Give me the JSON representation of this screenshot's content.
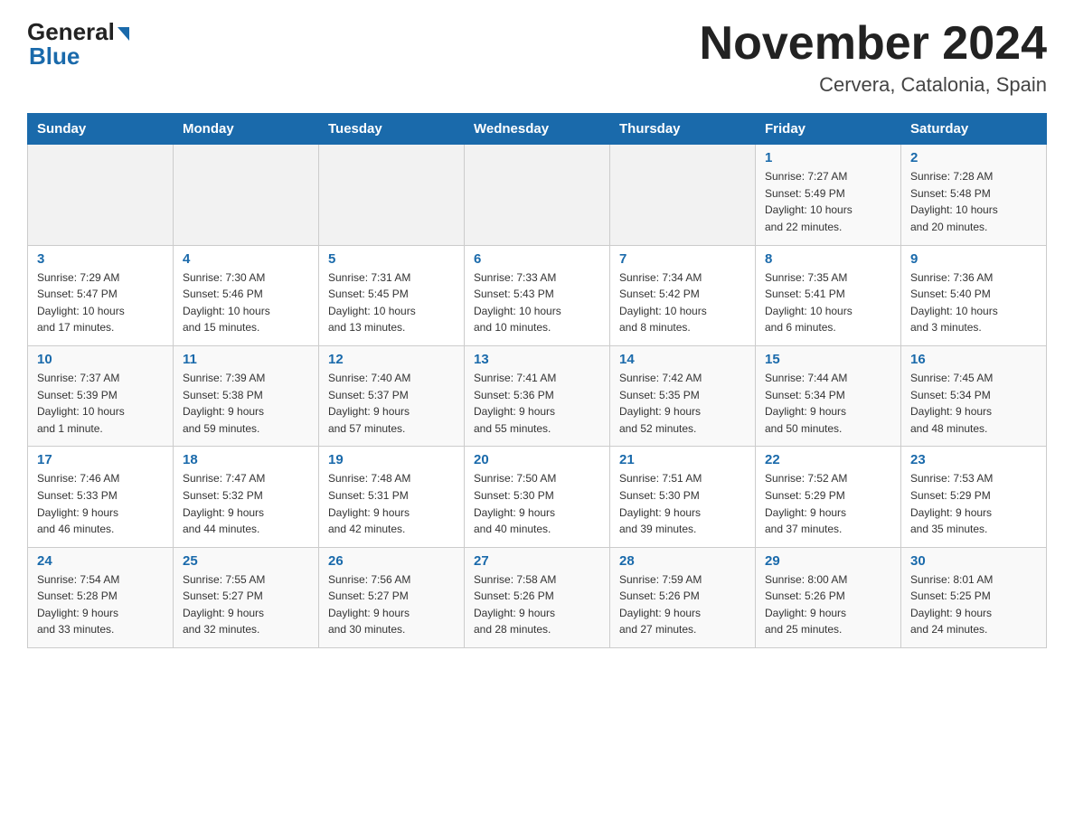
{
  "header": {
    "logo_top": "General",
    "logo_bottom": "Blue",
    "title": "November 2024",
    "subtitle": "Cervera, Catalonia, Spain"
  },
  "days_of_week": [
    "Sunday",
    "Monday",
    "Tuesday",
    "Wednesday",
    "Thursday",
    "Friday",
    "Saturday"
  ],
  "weeks": [
    [
      {
        "day": "",
        "info": ""
      },
      {
        "day": "",
        "info": ""
      },
      {
        "day": "",
        "info": ""
      },
      {
        "day": "",
        "info": ""
      },
      {
        "day": "",
        "info": ""
      },
      {
        "day": "1",
        "info": "Sunrise: 7:27 AM\nSunset: 5:49 PM\nDaylight: 10 hours\nand 22 minutes."
      },
      {
        "day": "2",
        "info": "Sunrise: 7:28 AM\nSunset: 5:48 PM\nDaylight: 10 hours\nand 20 minutes."
      }
    ],
    [
      {
        "day": "3",
        "info": "Sunrise: 7:29 AM\nSunset: 5:47 PM\nDaylight: 10 hours\nand 17 minutes."
      },
      {
        "day": "4",
        "info": "Sunrise: 7:30 AM\nSunset: 5:46 PM\nDaylight: 10 hours\nand 15 minutes."
      },
      {
        "day": "5",
        "info": "Sunrise: 7:31 AM\nSunset: 5:45 PM\nDaylight: 10 hours\nand 13 minutes."
      },
      {
        "day": "6",
        "info": "Sunrise: 7:33 AM\nSunset: 5:43 PM\nDaylight: 10 hours\nand 10 minutes."
      },
      {
        "day": "7",
        "info": "Sunrise: 7:34 AM\nSunset: 5:42 PM\nDaylight: 10 hours\nand 8 minutes."
      },
      {
        "day": "8",
        "info": "Sunrise: 7:35 AM\nSunset: 5:41 PM\nDaylight: 10 hours\nand 6 minutes."
      },
      {
        "day": "9",
        "info": "Sunrise: 7:36 AM\nSunset: 5:40 PM\nDaylight: 10 hours\nand 3 minutes."
      }
    ],
    [
      {
        "day": "10",
        "info": "Sunrise: 7:37 AM\nSunset: 5:39 PM\nDaylight: 10 hours\nand 1 minute."
      },
      {
        "day": "11",
        "info": "Sunrise: 7:39 AM\nSunset: 5:38 PM\nDaylight: 9 hours\nand 59 minutes."
      },
      {
        "day": "12",
        "info": "Sunrise: 7:40 AM\nSunset: 5:37 PM\nDaylight: 9 hours\nand 57 minutes."
      },
      {
        "day": "13",
        "info": "Sunrise: 7:41 AM\nSunset: 5:36 PM\nDaylight: 9 hours\nand 55 minutes."
      },
      {
        "day": "14",
        "info": "Sunrise: 7:42 AM\nSunset: 5:35 PM\nDaylight: 9 hours\nand 52 minutes."
      },
      {
        "day": "15",
        "info": "Sunrise: 7:44 AM\nSunset: 5:34 PM\nDaylight: 9 hours\nand 50 minutes."
      },
      {
        "day": "16",
        "info": "Sunrise: 7:45 AM\nSunset: 5:34 PM\nDaylight: 9 hours\nand 48 minutes."
      }
    ],
    [
      {
        "day": "17",
        "info": "Sunrise: 7:46 AM\nSunset: 5:33 PM\nDaylight: 9 hours\nand 46 minutes."
      },
      {
        "day": "18",
        "info": "Sunrise: 7:47 AM\nSunset: 5:32 PM\nDaylight: 9 hours\nand 44 minutes."
      },
      {
        "day": "19",
        "info": "Sunrise: 7:48 AM\nSunset: 5:31 PM\nDaylight: 9 hours\nand 42 minutes."
      },
      {
        "day": "20",
        "info": "Sunrise: 7:50 AM\nSunset: 5:30 PM\nDaylight: 9 hours\nand 40 minutes."
      },
      {
        "day": "21",
        "info": "Sunrise: 7:51 AM\nSunset: 5:30 PM\nDaylight: 9 hours\nand 39 minutes."
      },
      {
        "day": "22",
        "info": "Sunrise: 7:52 AM\nSunset: 5:29 PM\nDaylight: 9 hours\nand 37 minutes."
      },
      {
        "day": "23",
        "info": "Sunrise: 7:53 AM\nSunset: 5:29 PM\nDaylight: 9 hours\nand 35 minutes."
      }
    ],
    [
      {
        "day": "24",
        "info": "Sunrise: 7:54 AM\nSunset: 5:28 PM\nDaylight: 9 hours\nand 33 minutes."
      },
      {
        "day": "25",
        "info": "Sunrise: 7:55 AM\nSunset: 5:27 PM\nDaylight: 9 hours\nand 32 minutes."
      },
      {
        "day": "26",
        "info": "Sunrise: 7:56 AM\nSunset: 5:27 PM\nDaylight: 9 hours\nand 30 minutes."
      },
      {
        "day": "27",
        "info": "Sunrise: 7:58 AM\nSunset: 5:26 PM\nDaylight: 9 hours\nand 28 minutes."
      },
      {
        "day": "28",
        "info": "Sunrise: 7:59 AM\nSunset: 5:26 PM\nDaylight: 9 hours\nand 27 minutes."
      },
      {
        "day": "29",
        "info": "Sunrise: 8:00 AM\nSunset: 5:26 PM\nDaylight: 9 hours\nand 25 minutes."
      },
      {
        "day": "30",
        "info": "Sunrise: 8:01 AM\nSunset: 5:25 PM\nDaylight: 9 hours\nand 24 minutes."
      }
    ]
  ]
}
